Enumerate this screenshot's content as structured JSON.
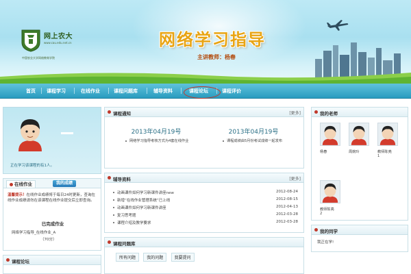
{
  "banner": {
    "logo_cn": "网上农大",
    "logo_url": "www.cau.edu.net.cn",
    "logo_sub": "中国农业大学网络教育学院",
    "title": "网络学习指导",
    "subtitle": "主讲教师：杨春"
  },
  "nav": {
    "items": [
      "首页",
      "课程学习",
      "在线作业",
      "课程问题库",
      "辅导资料",
      "课程论坛",
      "课程评价"
    ],
    "highlighted": "课程论坛",
    "highlight_color": "#c0392b"
  },
  "profile": {
    "status_text": "正在学习该课程的有1人。"
  },
  "homework": {
    "tab_label": "在线作业",
    "tab_button": "我的成绩",
    "warning_label": "温馨提示！",
    "warning_text": "在线作业成绩将于每日24时更新，查询在线作业成绩请勿在该课程在线作业提交后立即查询。",
    "done_label": "已完成作业",
    "done_item": "网络学习指导_在线作业_A",
    "done_count": "（70分）"
  },
  "bottom_left": {
    "title": "课程论坛"
  },
  "notice": {
    "title": "课程通知",
    "more": "[更多]",
    "cards": [
      {
        "date": "2013年04月19号",
        "desc": "网络学习指导考核方式为4套在线作业"
      },
      {
        "date": "2013年04月19号",
        "desc": "课程成绩由5月份考试成绩一起发布"
      }
    ]
  },
  "guide": {
    "title": "辅导资料",
    "more": "[更多]",
    "rows": [
      {
        "text": "动画课件如何学习新课件讲座new",
        "date": "2012-08-24"
      },
      {
        "text": "新增“在线作业管理系统”已上线",
        "date": "2012-08-15"
      },
      {
        "text": "动画课件如何学习新课件讲座",
        "date": "2012-04-13"
      },
      {
        "text": "复习思考题",
        "date": "2012-03-28"
      },
      {
        "text": "课程介绍及教学要求",
        "date": "2012-03-28"
      }
    ]
  },
  "qbank": {
    "title": "课程问题库",
    "tabs": [
      "所有问题",
      "我的问题",
      "我要提问"
    ]
  },
  "teachers": {
    "title": "我的老师",
    "list": [
      {
        "name": "杨春",
        "info": ""
      },
      {
        "name": "周婉玲",
        "info": ""
      },
      {
        "name": "教师陈亮",
        "info": "1"
      },
      {
        "name": "教师陈亮",
        "info": "2"
      }
    ]
  },
  "classmates": {
    "title": "我的同学",
    "welcome": "我正在学!"
  }
}
